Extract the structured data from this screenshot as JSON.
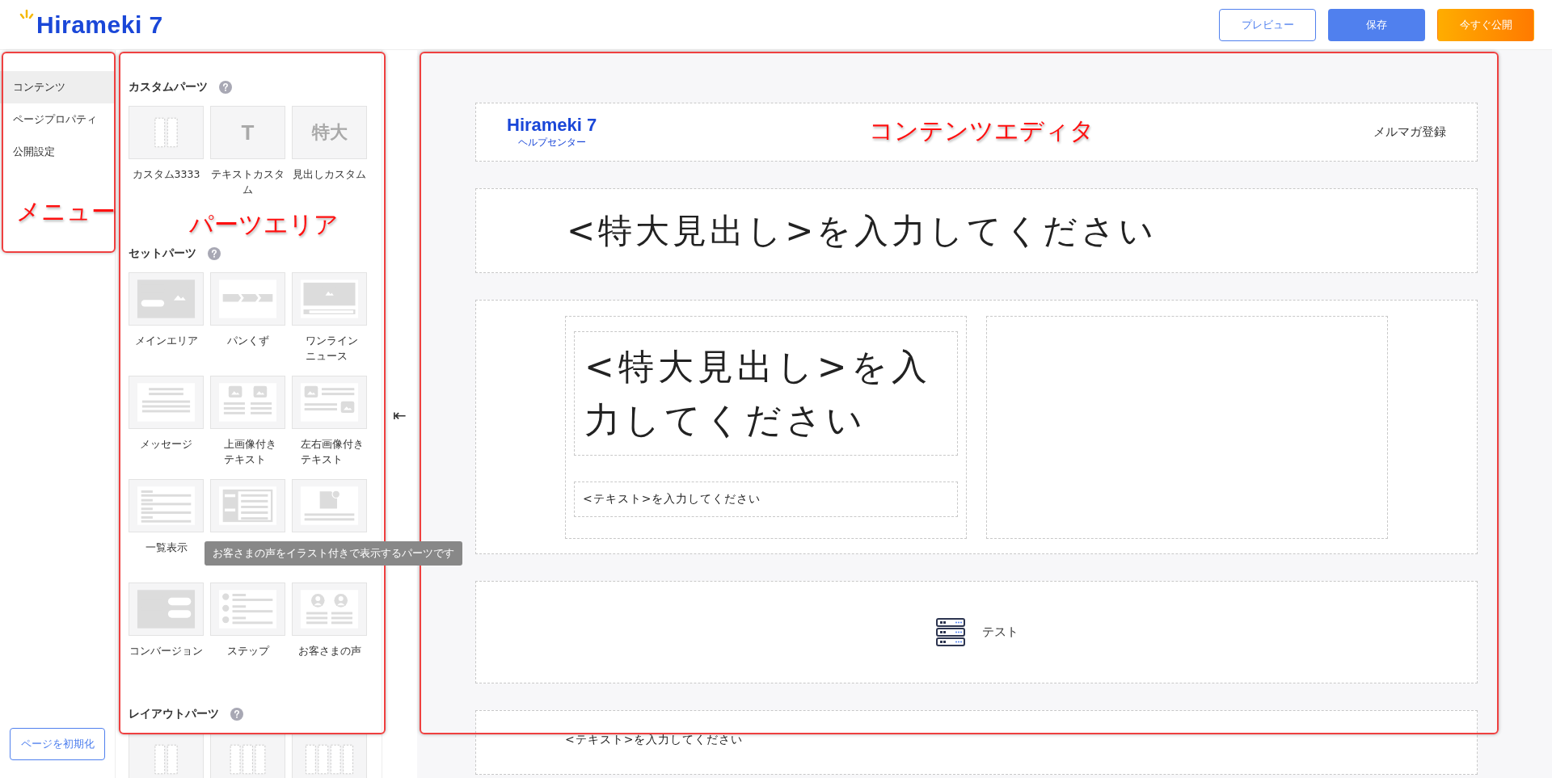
{
  "header": {
    "logo": "Hirameki 7",
    "buttons": [
      {
        "label": "プレビュー",
        "kind": "outline"
      },
      {
        "label": "保存",
        "kind": "primary"
      },
      {
        "label": "今すぐ公開",
        "kind": "accent"
      }
    ]
  },
  "menu": {
    "items": [
      {
        "label": "コンテンツ",
        "selected": true
      },
      {
        "label": "ページプロパティ",
        "selected": false
      },
      {
        "label": "公開設定",
        "selected": false
      }
    ],
    "reset_button": "ページを初期化"
  },
  "parts": {
    "sections": [
      {
        "title": "カスタムパーツ",
        "items": [
          {
            "label": "カスタム3333",
            "kind": "columns2"
          },
          {
            "label": "テキストカスタム",
            "kind": "glyph",
            "glyph": "T"
          },
          {
            "label": "見出しカスタム",
            "kind": "glyph",
            "glyph": "特大"
          }
        ]
      },
      {
        "title": "セットパーツ",
        "items": [
          {
            "label": "メインエリア",
            "kind": "main"
          },
          {
            "label": "パンくず",
            "kind": "breadcrumb"
          },
          {
            "label": "ワンラインニュース",
            "kind": "news"
          },
          {
            "label": "メッセージ",
            "kind": "message"
          },
          {
            "label": "上画像付きテキスト",
            "kind": "image-top"
          },
          {
            "label": "左右画像付きテキスト",
            "kind": "image-side"
          },
          {
            "label": "一覧表示",
            "kind": "list"
          },
          {
            "kind": "company"
          },
          {
            "kind": "map"
          },
          {
            "label": "コンバージョン",
            "kind": "conversion"
          },
          {
            "label": "ステップ",
            "kind": "steps"
          },
          {
            "label": "お客さまの声",
            "kind": "voice"
          }
        ]
      },
      {
        "title": "レイアウトパーツ",
        "items": [
          {
            "kind": "columns2"
          },
          {
            "kind": "columns3"
          },
          {
            "kind": "columns4"
          }
        ]
      }
    ],
    "tooltip": "お客さまの声をイラスト付きで表示するパーツです",
    "collapse": "⇤"
  },
  "editor": {
    "site_logo": "Hirameki 7",
    "site_logo_sub": "ヘルプセンター",
    "header_link": "メルマガ登録",
    "blocks": [
      {
        "kind": "heading",
        "text": "<特大見出し>を入力してください"
      },
      {
        "kind": "two-column",
        "heading": "<特大見出し>を入力してください",
        "text": "<テキスト>を入力してください"
      },
      {
        "kind": "icon-text",
        "text": "テスト"
      },
      {
        "kind": "text",
        "text": "<テキスト>を入力してください"
      }
    ]
  },
  "annotations": [
    {
      "label": "メニュー"
    },
    {
      "label": "パーツエリア"
    },
    {
      "label": "コンテンツエディタ"
    }
  ]
}
